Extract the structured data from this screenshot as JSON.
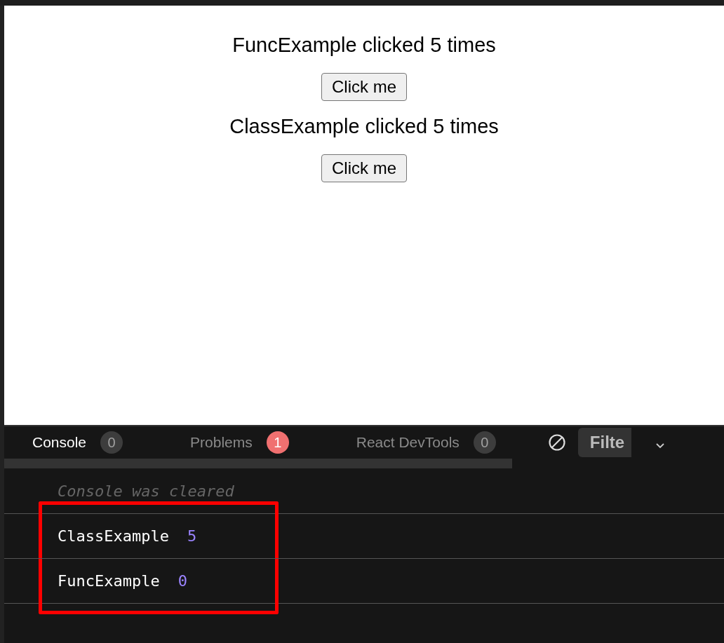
{
  "preview": {
    "sections": [
      {
        "heading": "FuncExample clicked 5 times",
        "button": "Click me"
      },
      {
        "heading": "ClassExample clicked 5 times",
        "button": "Click me"
      }
    ]
  },
  "console_panel": {
    "tabs": [
      {
        "label": "Console",
        "count": "0",
        "selected": true,
        "alert": false
      },
      {
        "label": "Problems",
        "count": "1",
        "selected": false,
        "alert": true
      },
      {
        "label": "React DevTools",
        "count": "0",
        "selected": false,
        "alert": false
      }
    ],
    "filter": {
      "value": "Filte"
    },
    "cleared_message": "Console was cleared",
    "logs": [
      {
        "name": "ClassExample",
        "value": "5",
        "highlighted": true
      },
      {
        "name": "FuncExample",
        "value": "0",
        "highlighted": true
      }
    ]
  }
}
